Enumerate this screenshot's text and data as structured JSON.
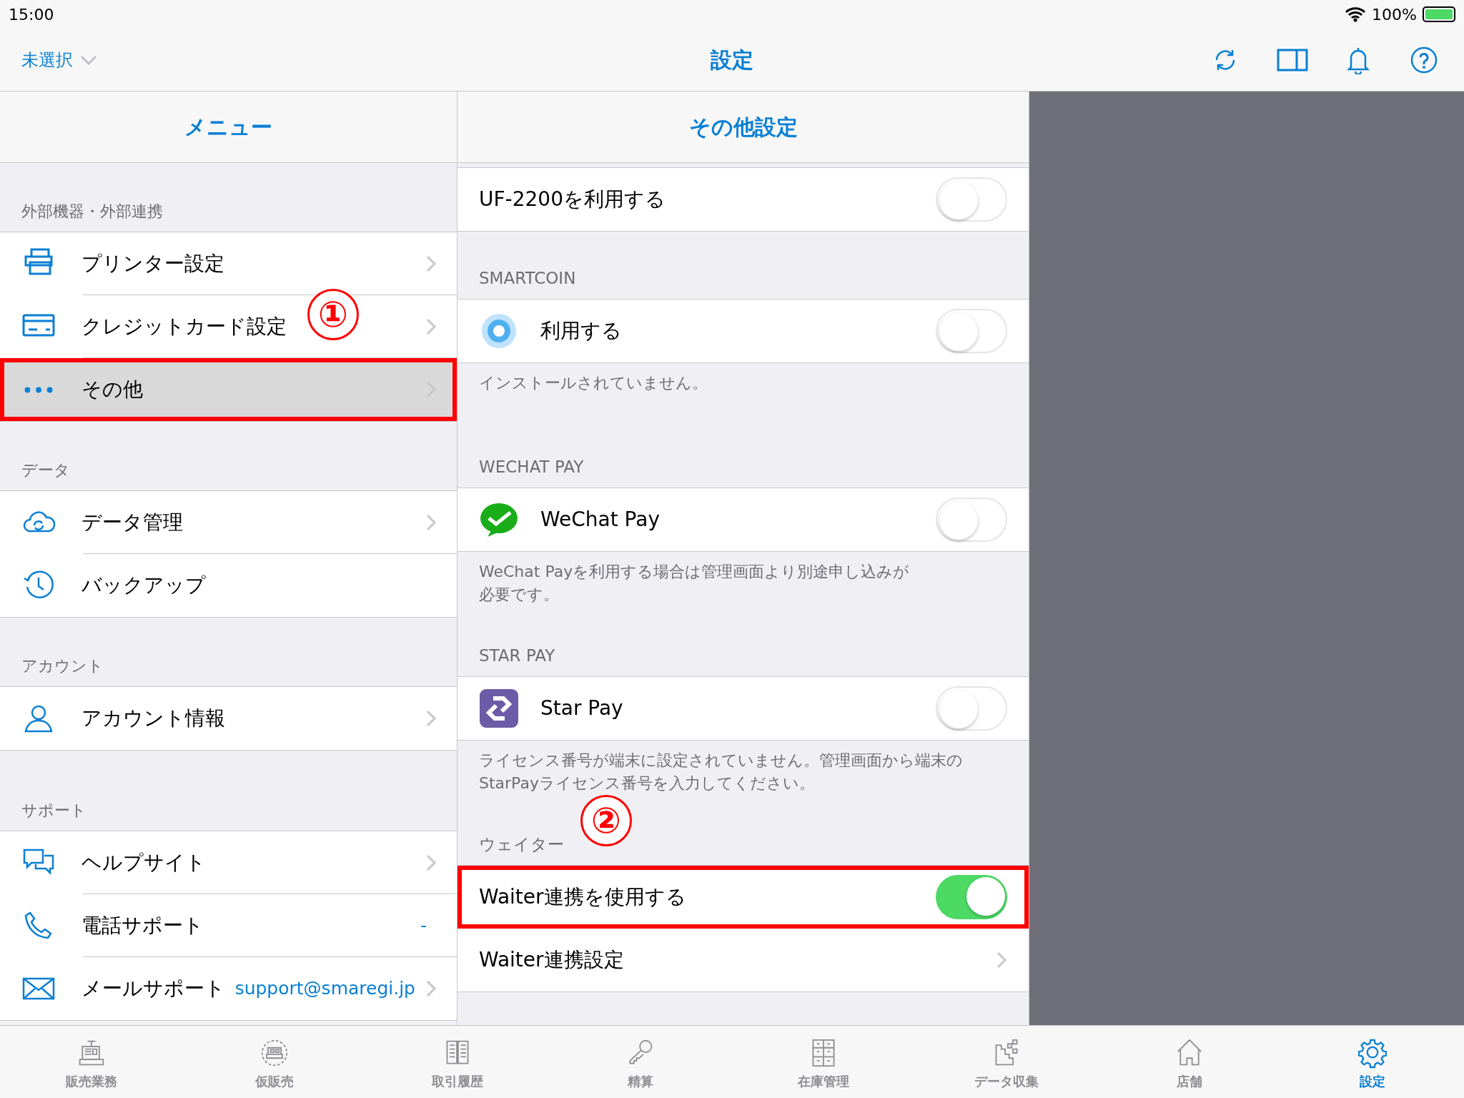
{
  "status_bar": {
    "time": "15:00",
    "battery": "100%"
  },
  "nav_bar": {
    "left_button": "未選択",
    "title": "設定"
  },
  "menu": {
    "title": "メニュー",
    "sections": [
      {
        "header": "外部機器・外部連携",
        "items": [
          {
            "label": "プリンター設定",
            "chevron": true,
            "selected": false,
            "highlighted": false
          },
          {
            "label": "クレジットカード設定",
            "chevron": true,
            "selected": false,
            "highlighted": false
          },
          {
            "label": "その他",
            "chevron": true,
            "selected": true,
            "highlighted": true
          }
        ]
      },
      {
        "header": "データ",
        "items": [
          {
            "label": "データ管理",
            "chevron": true,
            "selected": false,
            "highlighted": false
          },
          {
            "label": "バックアップ",
            "chevron": false,
            "selected": false,
            "highlighted": false
          }
        ]
      },
      {
        "header": "アカウント",
        "items": [
          {
            "label": "アカウント情報",
            "chevron": true,
            "selected": false,
            "highlighted": false
          }
        ]
      },
      {
        "header": "サポート",
        "items": [
          {
            "label": "ヘルプサイト",
            "chevron": true,
            "selected": false,
            "highlighted": false
          },
          {
            "label": "電話サポート",
            "detail": "-",
            "chevron": false,
            "selected": false,
            "highlighted": false
          },
          {
            "label": "メールサポート",
            "detail": "support@smaregi.jp",
            "chevron": true,
            "selected": false,
            "highlighted": false
          }
        ]
      }
    ]
  },
  "settings_panel": {
    "title": "その他設定",
    "sections": [
      {
        "rows": [
          {
            "label": "UF-2200を利用する",
            "kind": "toggle",
            "on": false,
            "highlighted": false
          }
        ]
      },
      {
        "header": "SMARTCOIN",
        "rows": [
          {
            "label": "利用する",
            "kind": "toggle",
            "on": false,
            "highlighted": false
          }
        ],
        "footer": "インストールされていません。"
      },
      {
        "header": "WECHAT PAY",
        "rows": [
          {
            "label": "WeChat Pay",
            "kind": "toggle",
            "on": false,
            "highlighted": false
          }
        ],
        "footer": "WeChat Payを利用する場合は管理画面より別途申し込みが必要です。"
      },
      {
        "header": "STAR PAY",
        "rows": [
          {
            "label": "Star Pay",
            "kind": "toggle",
            "on": false,
            "highlighted": false
          }
        ],
        "footer": "ライセンス番号が端末に設定されていません。管理画面から端末のStarPayライセンス番号を入力してください。"
      },
      {
        "header": "ウェイター",
        "rows": [
          {
            "label": "Waiter連携を使用する",
            "kind": "toggle",
            "on": true,
            "highlighted": true
          },
          {
            "label": "Waiter連携設定",
            "kind": "link",
            "highlighted": false
          }
        ]
      }
    ]
  },
  "annotations": [
    {
      "label": "①"
    },
    {
      "label": "②"
    }
  ],
  "tab_bar": [
    {
      "label": "販売業務",
      "selected": false
    },
    {
      "label": "仮販売",
      "selected": false
    },
    {
      "label": "取引履歴",
      "selected": false
    },
    {
      "label": "精算",
      "selected": false
    },
    {
      "label": "在庫管理",
      "selected": false
    },
    {
      "label": "データ収集",
      "selected": false
    },
    {
      "label": "店舗",
      "selected": false
    },
    {
      "label": "設定",
      "selected": true
    }
  ]
}
